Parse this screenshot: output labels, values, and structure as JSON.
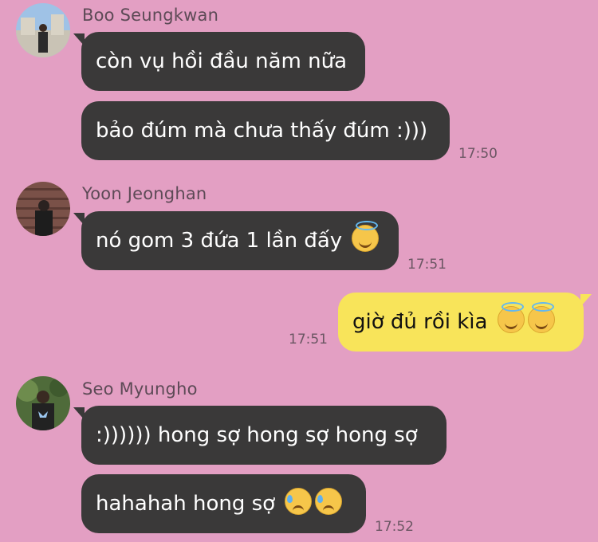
{
  "chat": {
    "groups": [
      {
        "sender": "Boo Seungkwan",
        "avatar_icon": "avatar-photo-icon",
        "messages": [
          "còn vụ hồi đầu năm nữa",
          "bảo đúm mà chưa thấy đúm :)))"
        ],
        "time": "17:50"
      },
      {
        "sender": "Yoon Jeonghan",
        "avatar_icon": "avatar-photo-icon",
        "messages": [
          "nó gom 3 đứa 1 lần đấy"
        ],
        "emoji": "smiling-face-with-halo-icon",
        "time": "17:51"
      },
      {
        "sender": "me",
        "messages": [
          "giờ đủ rồi kìa"
        ],
        "emoji": "smiling-face-with-halo-icon",
        "time": "17:51"
      },
      {
        "sender": "Seo Myungho",
        "avatar_icon": "avatar-photo-icon",
        "messages": [
          ":)))))) hong sợ hong sợ hong sợ",
          "hahahah hong sợ"
        ],
        "emoji": "sad-but-relieved-face-icon",
        "time": "17:52"
      }
    ]
  },
  "colors": {
    "background": "#e39fc3",
    "incoming_bubble": "#3a3939",
    "outgoing_bubble": "#f8e45a"
  }
}
